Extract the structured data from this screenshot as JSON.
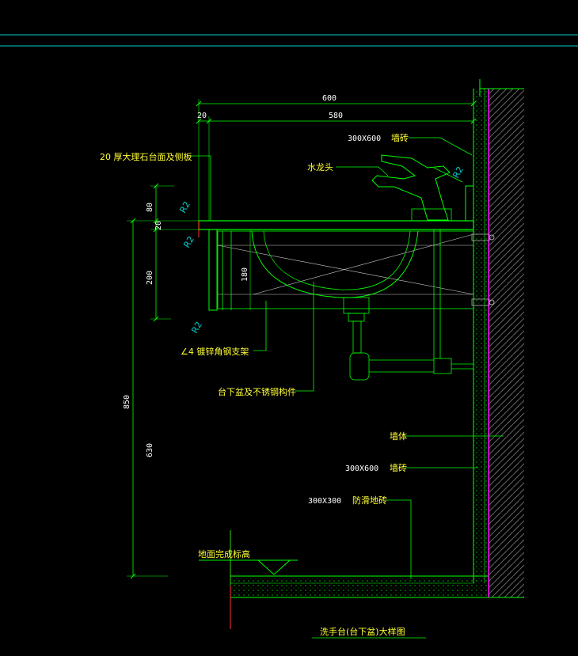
{
  "dimensions": {
    "top_total": "600",
    "top_offset": "20",
    "top_inner": "580",
    "left_80": "80",
    "left_20": "20",
    "left_200": "200",
    "left_850": "850",
    "left_630": "630",
    "inner_180": "180"
  },
  "labels": {
    "countertop": "20 厚大理石台面及侧板",
    "faucet": "水龙头",
    "wall_tile_top_code": "300X600",
    "wall_tile_top": "墙砖",
    "bracket": "∠4 镀锌角钢支架",
    "basin": "台下盆及不锈钢构件",
    "wall_body": "墙体",
    "wall_tile_bottom_code": "300X600",
    "wall_tile_bottom": "墙砖",
    "floor_tile_code": "300X300",
    "floor_tile": "防滑地砖",
    "floor_level": "地面完成标高",
    "title": "洗手台(台下盆)大样图"
  },
  "radius_marks": [
    "R2",
    "R2",
    "R2",
    "R2"
  ],
  "colors": {
    "background": "#000000",
    "line": "#00ff00",
    "text": "#ffff33",
    "dimension_text": "#ffffff",
    "wall_hatch": "#cc00cc",
    "radius": "#00cccc",
    "frame": "#ff3333"
  }
}
